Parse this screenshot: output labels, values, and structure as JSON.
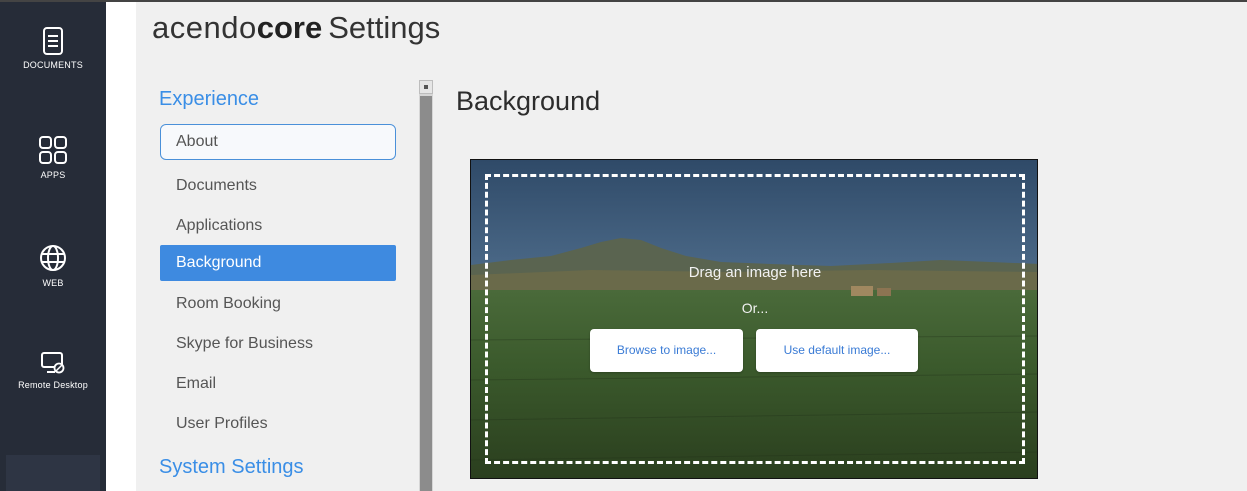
{
  "rail": {
    "items": [
      {
        "label": "DOCUMENTS",
        "icon": "document-icon"
      },
      {
        "label": "APPS",
        "icon": "apps-grid-icon"
      },
      {
        "label": "WEB",
        "icon": "globe-icon"
      },
      {
        "label": "Remote Desktop",
        "icon": "remote-desktop-icon"
      }
    ]
  },
  "header": {
    "brand_light": "acendo",
    "brand_bold": "core",
    "title": "Settings"
  },
  "menu": {
    "group_experience": "Experience",
    "items": [
      {
        "label": "About",
        "state": "hover"
      },
      {
        "label": "Documents",
        "state": "normal"
      },
      {
        "label": "Applications",
        "state": "normal"
      },
      {
        "label": "Background",
        "state": "selected"
      },
      {
        "label": "Room Booking",
        "state": "normal"
      },
      {
        "label": "Skype for Business",
        "state": "normal"
      },
      {
        "label": "Email",
        "state": "normal"
      },
      {
        "label": "User Profiles",
        "state": "normal"
      }
    ],
    "group_system": "System Settings"
  },
  "content": {
    "title": "Background",
    "drop_text": "Drag an image here",
    "or_text": "Or...",
    "browse_label": "Browse to image...",
    "default_label": "Use default image..."
  },
  "colors": {
    "rail_bg": "#262c38",
    "accent": "#3e8ae0",
    "group_title": "#3a8ee6",
    "panel_bg": "#f0f0f0"
  }
}
